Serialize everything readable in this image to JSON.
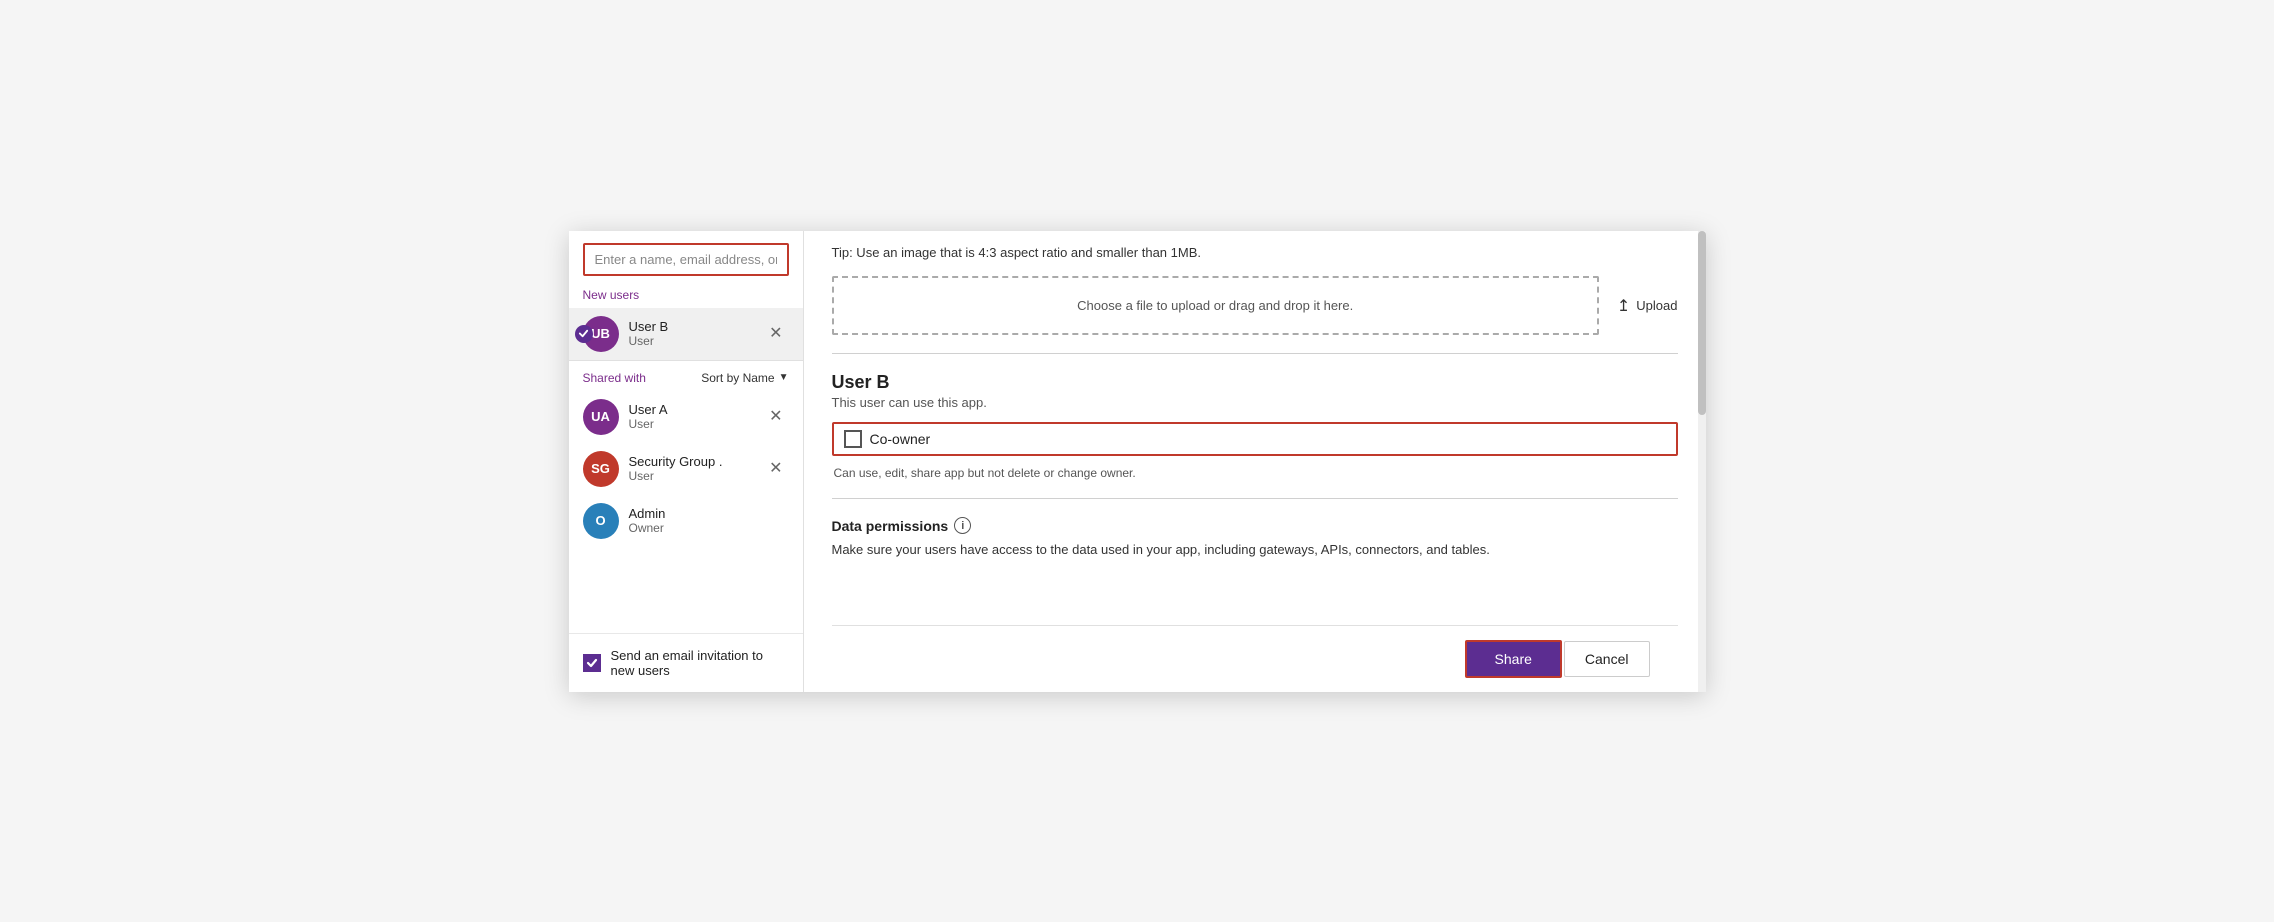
{
  "search": {
    "placeholder": "Enter a name, email address, or Everyone"
  },
  "new_users_label": "New users",
  "selected_user": {
    "initials": "UB",
    "name": "User B",
    "role": "User",
    "avatar_color": "#7b2d8b"
  },
  "shared_with_label": "Shared with",
  "sort_label": "Sort by Name",
  "shared_users": [
    {
      "initials": "UA",
      "name": "User A",
      "role": "User",
      "avatar_color": "#7b2d8b"
    },
    {
      "initials": "SG",
      "name": "Security Group .",
      "role": "User",
      "avatar_color": "#c0392b"
    },
    {
      "initials": "O",
      "name": "Admin",
      "role": "Owner",
      "avatar_color": "#2980b9"
    }
  ],
  "email_invite_label": "Send an email invitation to new users",
  "right": {
    "tip": "Tip: Use an image that is 4:3 aspect ratio and smaller than 1MB.",
    "upload_zone_text": "Choose a file to upload or drag and drop it here.",
    "upload_btn_label": "Upload",
    "user_b_name": "User B",
    "user_b_desc": "This user can use this app.",
    "coowner_label": "Co-owner",
    "coowner_sub": "Can use, edit, share app but not delete or change owner.",
    "data_permissions_title": "Data permissions",
    "data_permissions_desc": "Make sure your users have access to the data used in your app, including gateways, APIs, connectors, and tables."
  },
  "footer": {
    "share_label": "Share",
    "cancel_label": "Cancel"
  }
}
